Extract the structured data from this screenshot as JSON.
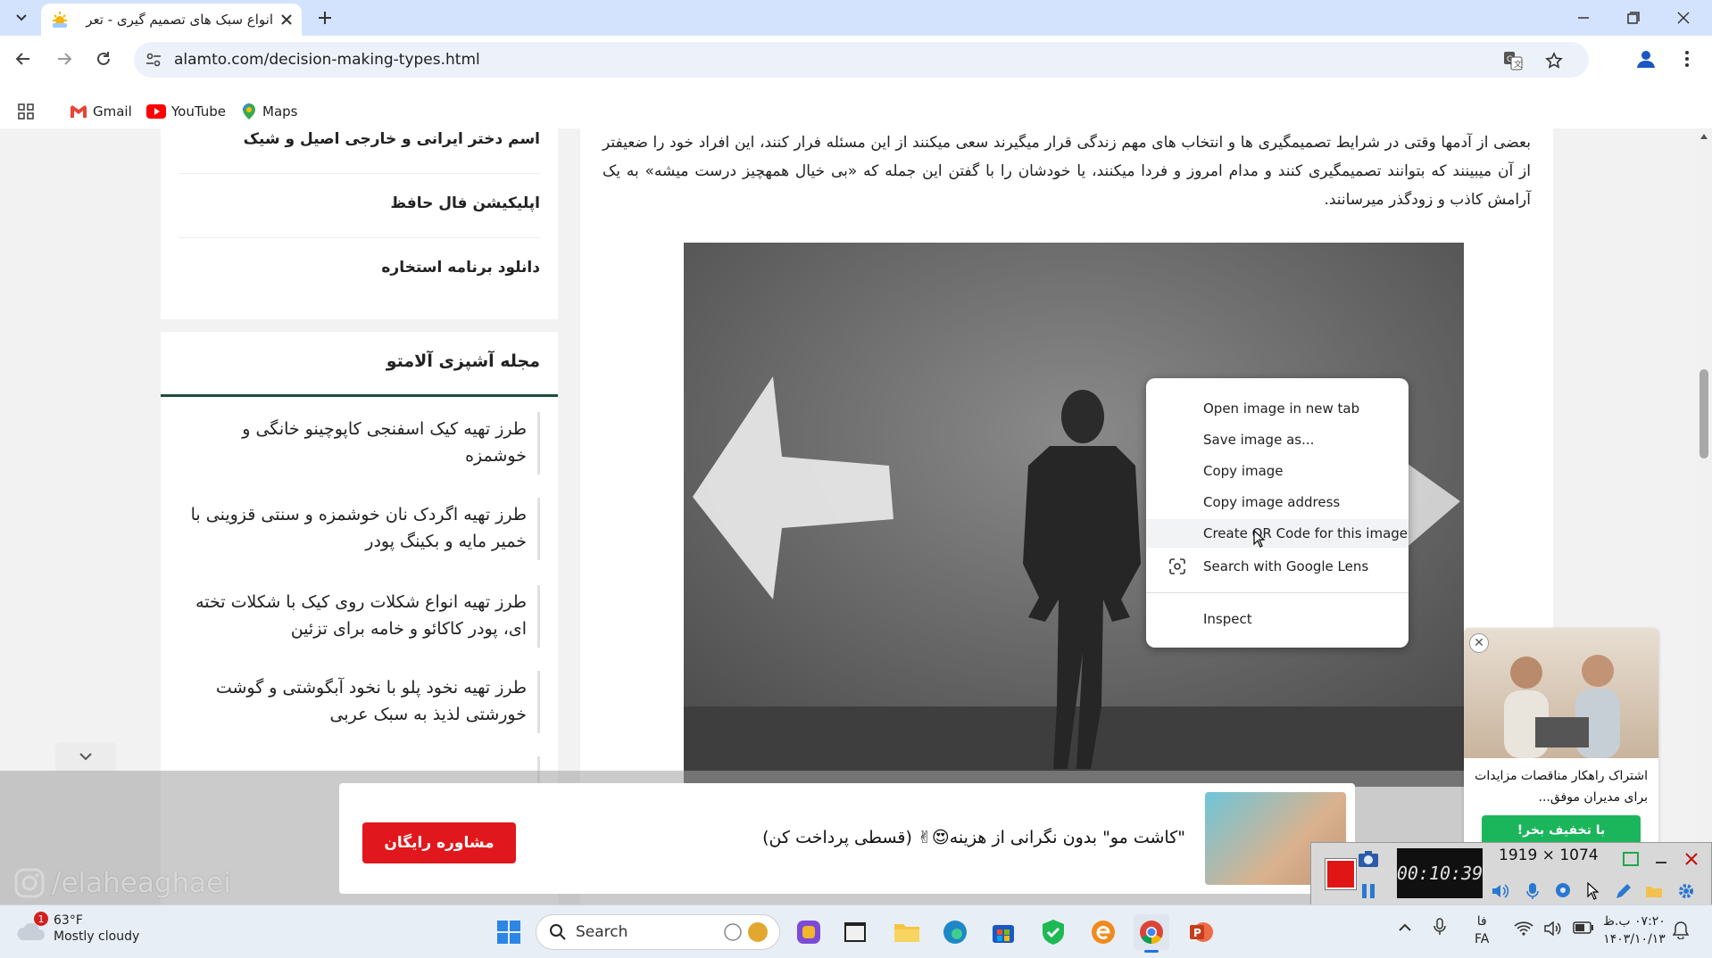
{
  "browser": {
    "tab_title": "انواع سبک های تصمیم گیری - تعر",
    "url": "alamto.com/decision-making-types.html",
    "bookmarks": [
      {
        "label": "Gmail",
        "icon": "gmail-icon"
      },
      {
        "label": "YouTube",
        "icon": "youtube-icon"
      },
      {
        "label": "Maps",
        "icon": "maps-icon"
      }
    ]
  },
  "sidebar": {
    "top_links": [
      "اسم دختر ایرانی و خارجی اصیل و شیک",
      "اپلیکیشن فال حافظ",
      "دانلود برنامه استخاره"
    ],
    "magazine_title": "مجله آشپزی آلامتو",
    "recipes": [
      "طرز تهیه کیک اسفنجی کاپوچینو خانگی و خوشمزه",
      "طرز تهیه اگردک نان خوشمزه و سنتی قزوینی با خمیر مایه و بکینگ پودر",
      "طرز تهیه انواع شکلات روی کیک با شکلات تخته ای، پودر کاکائو و خامه برای تزئین",
      "طرز تهیه نخود پلو با نخود آبگوشتی و گوشت خورشتی لذیذ به سبک عربی"
    ]
  },
  "article": {
    "paragraph": "بعضی از آدمها وقتی در شرایط تصمیمگیری ها و انتخاب های مهم زندگی قرار میگیرند سعی میکنند از این مسئله فرار کنند، این افراد خود را ضعیفتر از آن میبینند که بتوانند تصمیمگیری کنند و مدام امروز و فردا میکنند، یا خودشان را با گفتن این جمله که «بی خیال همهچیز درست میشه» به یک آرامش کاذب و زودگذر میرسانند."
  },
  "context_menu": {
    "items": [
      {
        "label": "Open image in new tab"
      },
      {
        "label": "Save image as..."
      },
      {
        "label": "Copy image"
      },
      {
        "label": "Copy image address"
      },
      {
        "label": "Create QR Code for this image"
      },
      {
        "label": "Search with Google Lens"
      },
      {
        "label": "Inspect"
      }
    ]
  },
  "bottom_ad": {
    "button": "مشاوره رایگان",
    "text": "\"کاشت مو\" بدون نگرانی از هزینه😍✌ (قسطی پرداخت کن)"
  },
  "side_ad": {
    "text": "اشتراک راهکار مناقصات مزایدات برای مدیران موفق...",
    "button": "با تخفیف بخر!"
  },
  "watermark": "/elaheaghaei",
  "recorder": {
    "timer": "00:10:39",
    "dims": "1919 × 1074"
  },
  "taskbar": {
    "temperature": "63°F",
    "condition": "Mostly cloudy",
    "weather_badge": "1",
    "search_label": "Search",
    "lang_top": "فا",
    "lang_bottom": "FA",
    "time": "۰۷:۲۰ ب.ظ",
    "date": "۱۴۰۳/۱۰/۱۳"
  },
  "colors": {
    "tabstrip": "#d3e3fd",
    "ad_button": "#e0171c",
    "side_ad_button": "#1bb55c",
    "accent_line": "#1c4c3a"
  }
}
